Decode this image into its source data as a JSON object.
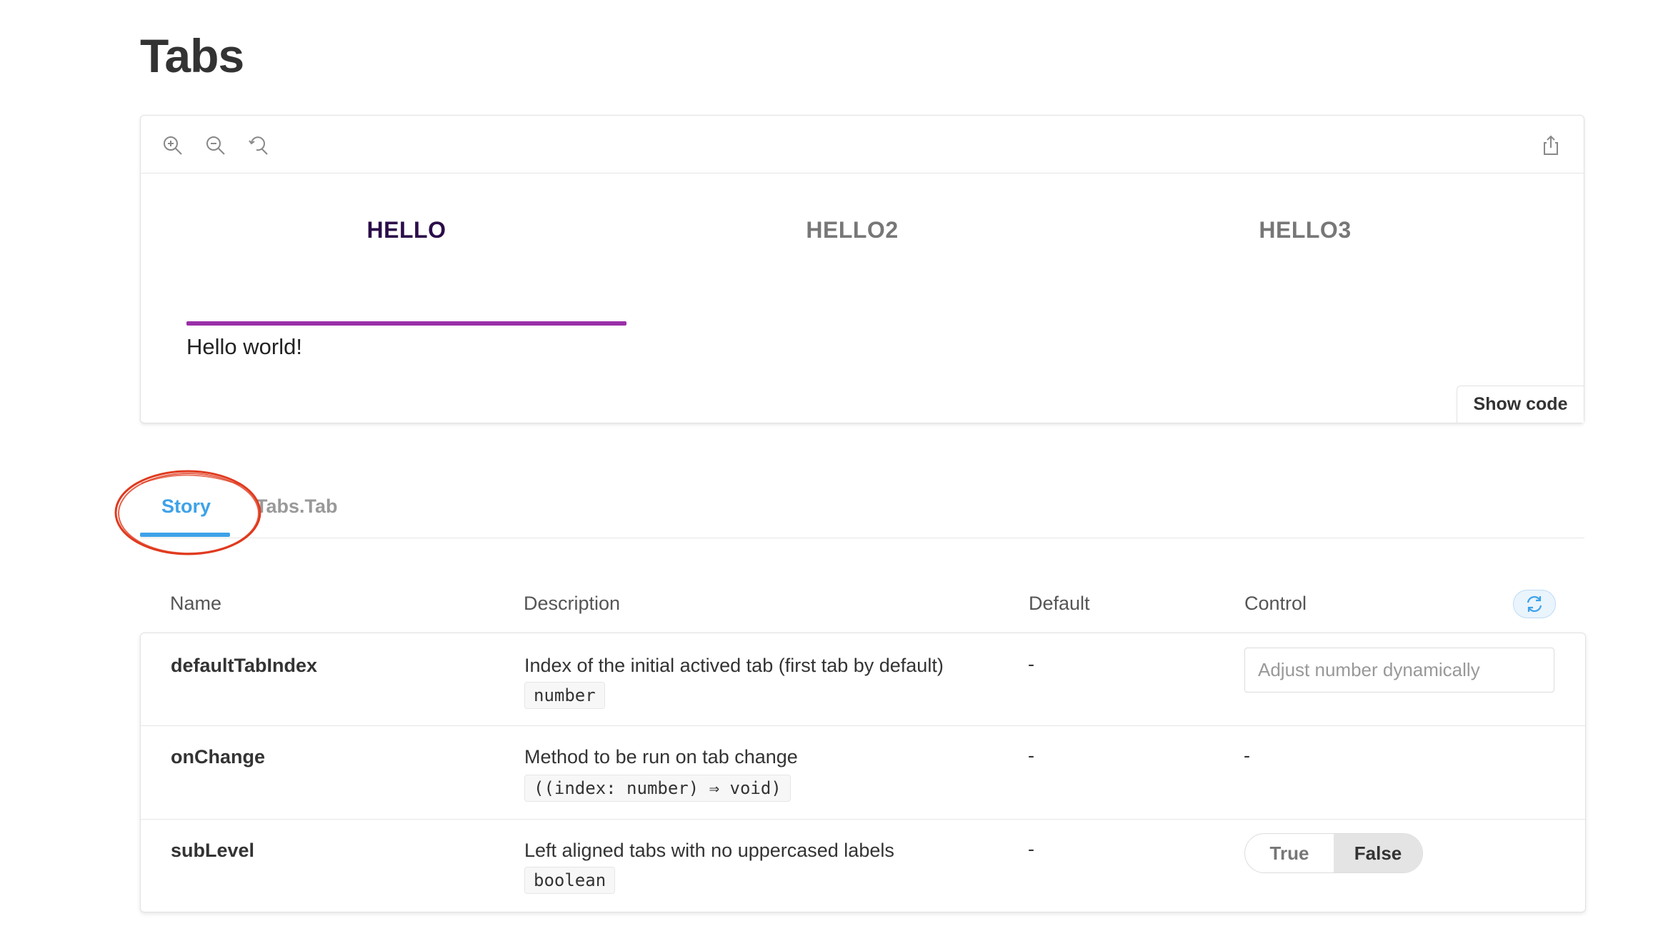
{
  "page": {
    "title": "Tabs"
  },
  "canvas": {
    "toolbar": {
      "zoom_in_icon": "zoom-in-icon",
      "zoom_out_icon": "zoom-out-icon",
      "reset_zoom_icon": "reset-zoom-icon",
      "share_icon": "share-icon"
    },
    "demo_tabs": [
      {
        "label": "HELLO",
        "active": true
      },
      {
        "label": "HELLO2",
        "active": false
      },
      {
        "label": "HELLO3",
        "active": false
      }
    ],
    "panel_text": "Hello world!",
    "show_code_label": "Show code",
    "colors": {
      "active_tab_text": "#2b0d4a",
      "active_tab_underline": "#9b2fa8"
    }
  },
  "addon_tabs": [
    {
      "label": "Story",
      "active": true
    },
    {
      "label": "Tabs.Tab",
      "active": false
    }
  ],
  "args_table": {
    "headers": {
      "name": "Name",
      "description": "Description",
      "default": "Default",
      "control": "Control"
    },
    "rows": [
      {
        "name": "defaultTabIndex",
        "description": "Index of the initial actived tab (first tab by default)",
        "type": "number",
        "default": "-",
        "control": {
          "kind": "number",
          "placeholder": "Adjust number dynamically"
        }
      },
      {
        "name": "onChange",
        "description": "Method to be run on tab change",
        "type": "((index: number) ⇒ void)",
        "default": "-",
        "control": {
          "kind": "none",
          "text": "-"
        }
      },
      {
        "name": "subLevel",
        "description": "Left aligned tabs with no uppercased labels",
        "type": "boolean",
        "default": "-",
        "control": {
          "kind": "boolean",
          "true_label": "True",
          "false_label": "False",
          "selected": "False"
        }
      }
    ]
  },
  "colors": {
    "accent": "#3ea2e8",
    "annotation": "#e03a1e"
  }
}
